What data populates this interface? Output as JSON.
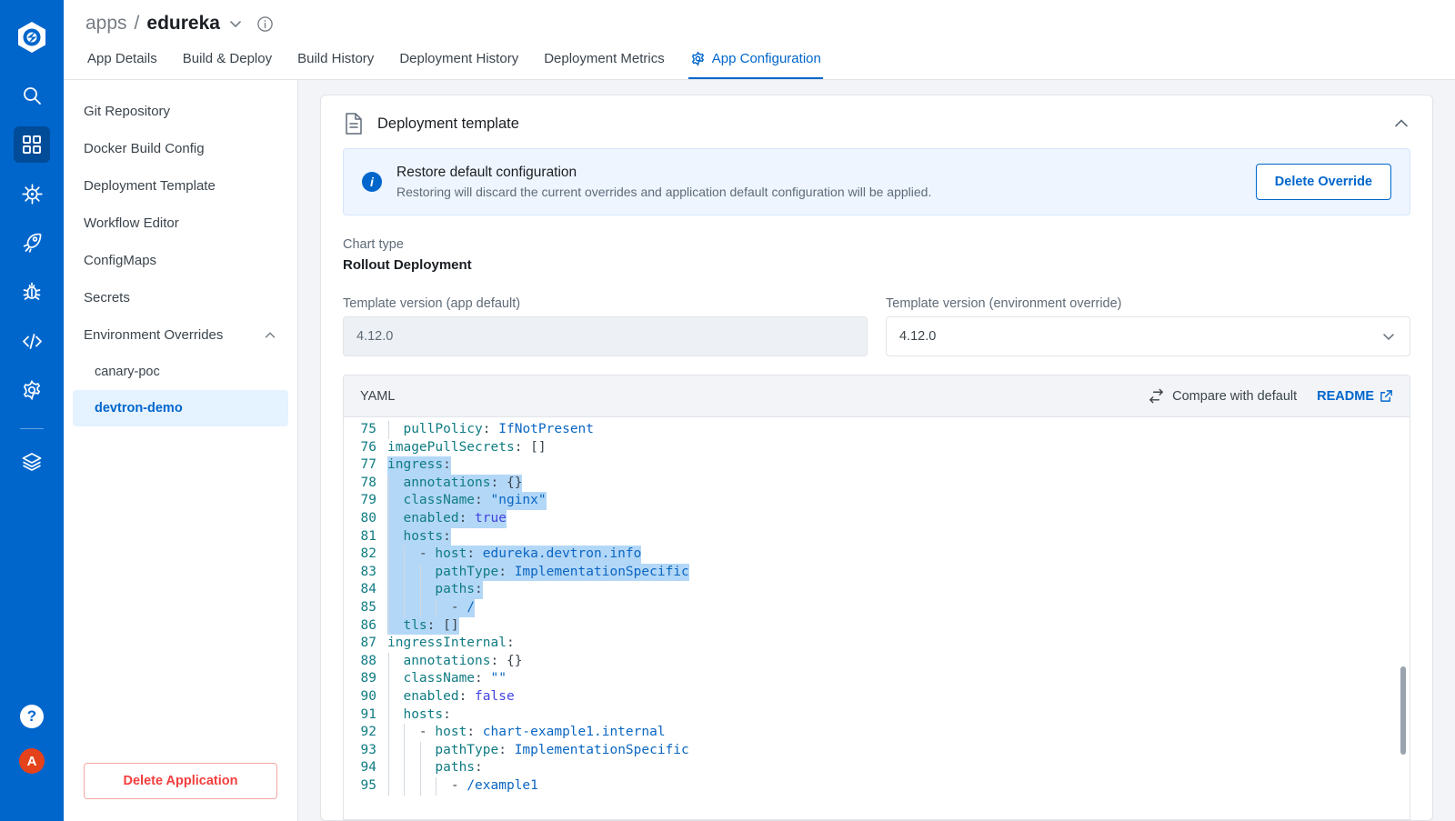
{
  "rail": {
    "logo_name": "devtron-logo",
    "items": [
      {
        "name": "search-icon",
        "label": "Search",
        "active": false
      },
      {
        "name": "apps-grid-icon",
        "label": "Applications",
        "active": true
      },
      {
        "name": "chart-store-icon",
        "label": "Chart Store",
        "active": false
      },
      {
        "name": "rocket-icon",
        "label": "Deployments",
        "active": false
      },
      {
        "name": "bug-icon",
        "label": "Security",
        "active": false
      },
      {
        "name": "code-icon",
        "label": "Jobs",
        "active": false
      },
      {
        "name": "gear-icon",
        "label": "Global Configurations",
        "active": false
      },
      {
        "name": "stack-icon",
        "label": "Stack Manager",
        "active": false
      }
    ],
    "help_label": "?",
    "avatar_label": "A"
  },
  "header": {
    "breadcrumb_root": "apps",
    "breadcrumb_sep": "/",
    "app_name": "edureka",
    "chevron_icon": "chevron-down-icon",
    "info_icon": "info-circle-icon",
    "tabs": [
      {
        "label": "App Details",
        "active": false
      },
      {
        "label": "Build & Deploy",
        "active": false
      },
      {
        "label": "Build History",
        "active": false
      },
      {
        "label": "Deployment History",
        "active": false
      },
      {
        "label": "Deployment Metrics",
        "active": false
      },
      {
        "label": "App Configuration",
        "active": true,
        "icon": "gear-icon"
      }
    ]
  },
  "sidebar": {
    "items": [
      {
        "label": "Git Repository",
        "type": "item"
      },
      {
        "label": "Docker Build Config",
        "type": "item"
      },
      {
        "label": "Deployment Template",
        "type": "item"
      },
      {
        "label": "Workflow Editor",
        "type": "item"
      },
      {
        "label": "ConfigMaps",
        "type": "item"
      },
      {
        "label": "Secrets",
        "type": "item"
      },
      {
        "label": "Environment Overrides",
        "type": "group",
        "expanded": true,
        "icon": "chevron-up-icon"
      },
      {
        "label": "canary-poc",
        "type": "sub",
        "selected": false
      },
      {
        "label": "devtron-demo",
        "type": "sub",
        "selected": true
      }
    ],
    "delete_app_label": "Delete Application"
  },
  "card": {
    "doc_icon": "document-icon",
    "title": "Deployment template",
    "collapse_icon": "chevron-up-icon",
    "banner": {
      "icon": "info-circle-filled-icon",
      "title": "Restore default configuration",
      "subtitle": "Restoring will discard the current overrides and application default configuration will be applied.",
      "button_label": "Delete Override"
    },
    "chart_type_label": "Chart type",
    "chart_type_value": "Rollout Deployment",
    "version_app_label": "Template version (app default)",
    "version_app_value": "4.12.0",
    "version_env_label": "Template version (environment override)",
    "version_env_value": "4.12.0",
    "version_env_chevron": "chevron-down-icon"
  },
  "editor": {
    "tab_label": "YAML",
    "compare_label": "Compare with default",
    "compare_icon": "compare-arrows-icon",
    "readme_label": "README",
    "readme_icon": "external-link-icon",
    "first_line": 75,
    "lines": [
      {
        "n": 75,
        "indent": 1,
        "guides": 1,
        "hl": false,
        "tokens": [
          {
            "t": "  ",
            "c": "p"
          },
          {
            "t": "pullPolicy",
            "c": "k"
          },
          {
            "t": ": ",
            "c": "p"
          },
          {
            "t": "IfNotPresent",
            "c": "s"
          }
        ]
      },
      {
        "n": 76,
        "indent": 0,
        "guides": 0,
        "hl": false,
        "tokens": [
          {
            "t": "imagePullSecrets",
            "c": "k"
          },
          {
            "t": ": []",
            "c": "p"
          }
        ]
      },
      {
        "n": 77,
        "indent": 0,
        "guides": 0,
        "hl": true,
        "tokens": [
          {
            "t": "ingress",
            "c": "k"
          },
          {
            "t": ":",
            "c": "p"
          }
        ]
      },
      {
        "n": 78,
        "indent": 1,
        "guides": 1,
        "hl": true,
        "tokens": [
          {
            "t": "  ",
            "c": "p"
          },
          {
            "t": "annotations",
            "c": "k"
          },
          {
            "t": ": {}",
            "c": "p"
          }
        ]
      },
      {
        "n": 79,
        "indent": 1,
        "guides": 1,
        "hl": true,
        "tokens": [
          {
            "t": "  ",
            "c": "p"
          },
          {
            "t": "className",
            "c": "k"
          },
          {
            "t": ": ",
            "c": "p"
          },
          {
            "t": "\"nginx\"",
            "c": "s"
          }
        ]
      },
      {
        "n": 80,
        "indent": 1,
        "guides": 1,
        "hl": true,
        "tokens": [
          {
            "t": "  ",
            "c": "p"
          },
          {
            "t": "enabled",
            "c": "k"
          },
          {
            "t": ": ",
            "c": "p"
          },
          {
            "t": "true",
            "c": "b"
          }
        ]
      },
      {
        "n": 81,
        "indent": 1,
        "guides": 1,
        "hl": true,
        "tokens": [
          {
            "t": "  ",
            "c": "p"
          },
          {
            "t": "hosts",
            "c": "k"
          },
          {
            "t": ":",
            "c": "p"
          }
        ]
      },
      {
        "n": 82,
        "indent": 2,
        "guides": 2,
        "hl": true,
        "tokens": [
          {
            "t": "    ",
            "c": "p"
          },
          {
            "t": "- ",
            "c": "d"
          },
          {
            "t": "host",
            "c": "k"
          },
          {
            "t": ": ",
            "c": "p"
          },
          {
            "t": "edureka.devtron.info",
            "c": "s"
          }
        ]
      },
      {
        "n": 83,
        "indent": 3,
        "guides": 3,
        "hl": true,
        "tokens": [
          {
            "t": "      ",
            "c": "p"
          },
          {
            "t": "pathType",
            "c": "k"
          },
          {
            "t": ": ",
            "c": "p"
          },
          {
            "t": "ImplementationSpecific",
            "c": "s"
          }
        ]
      },
      {
        "n": 84,
        "indent": 3,
        "guides": 3,
        "hl": true,
        "tokens": [
          {
            "t": "      ",
            "c": "p"
          },
          {
            "t": "paths",
            "c": "k"
          },
          {
            "t": ":",
            "c": "p"
          }
        ]
      },
      {
        "n": 85,
        "indent": 4,
        "guides": 4,
        "hl": true,
        "tokens": [
          {
            "t": "        ",
            "c": "p"
          },
          {
            "t": "- ",
            "c": "d"
          },
          {
            "t": "/",
            "c": "s"
          }
        ]
      },
      {
        "n": 86,
        "indent": 1,
        "guides": 1,
        "hl": true,
        "tokens": [
          {
            "t": "  ",
            "c": "p"
          },
          {
            "t": "tls",
            "c": "k"
          },
          {
            "t": ": []",
            "c": "p"
          }
        ]
      },
      {
        "n": 87,
        "indent": 0,
        "guides": 0,
        "hl": false,
        "tokens": [
          {
            "t": "ingressInternal",
            "c": "k"
          },
          {
            "t": ":",
            "c": "p"
          }
        ]
      },
      {
        "n": 88,
        "indent": 1,
        "guides": 1,
        "hl": false,
        "tokens": [
          {
            "t": "  ",
            "c": "p"
          },
          {
            "t": "annotations",
            "c": "k"
          },
          {
            "t": ": {}",
            "c": "p"
          }
        ]
      },
      {
        "n": 89,
        "indent": 1,
        "guides": 1,
        "hl": false,
        "tokens": [
          {
            "t": "  ",
            "c": "p"
          },
          {
            "t": "className",
            "c": "k"
          },
          {
            "t": ": ",
            "c": "p"
          },
          {
            "t": "\"\"",
            "c": "s"
          }
        ]
      },
      {
        "n": 90,
        "indent": 1,
        "guides": 1,
        "hl": false,
        "tokens": [
          {
            "t": "  ",
            "c": "p"
          },
          {
            "t": "enabled",
            "c": "k"
          },
          {
            "t": ": ",
            "c": "p"
          },
          {
            "t": "false",
            "c": "b"
          }
        ]
      },
      {
        "n": 91,
        "indent": 1,
        "guides": 1,
        "hl": false,
        "tokens": [
          {
            "t": "  ",
            "c": "p"
          },
          {
            "t": "hosts",
            "c": "k"
          },
          {
            "t": ":",
            "c": "p"
          }
        ]
      },
      {
        "n": 92,
        "indent": 2,
        "guides": 2,
        "hl": false,
        "tokens": [
          {
            "t": "    ",
            "c": "p"
          },
          {
            "t": "- ",
            "c": "d"
          },
          {
            "t": "host",
            "c": "k"
          },
          {
            "t": ": ",
            "c": "p"
          },
          {
            "t": "chart-example1.internal",
            "c": "s"
          }
        ]
      },
      {
        "n": 93,
        "indent": 3,
        "guides": 3,
        "hl": false,
        "tokens": [
          {
            "t": "      ",
            "c": "p"
          },
          {
            "t": "pathType",
            "c": "k"
          },
          {
            "t": ": ",
            "c": "p"
          },
          {
            "t": "ImplementationSpecific",
            "c": "s"
          }
        ]
      },
      {
        "n": 94,
        "indent": 3,
        "guides": 3,
        "hl": false,
        "tokens": [
          {
            "t": "      ",
            "c": "p"
          },
          {
            "t": "paths",
            "c": "k"
          },
          {
            "t": ":",
            "c": "p"
          }
        ]
      },
      {
        "n": 95,
        "indent": 4,
        "guides": 4,
        "hl": false,
        "tokens": [
          {
            "t": "        ",
            "c": "p"
          },
          {
            "t": "- ",
            "c": "d"
          },
          {
            "t": "/example1",
            "c": "s"
          }
        ]
      }
    ],
    "scrollbar": {
      "top_pct": 62,
      "height_pct": 22
    }
  },
  "colors": {
    "brand_blue": "#0066cc",
    "rail_active": "#004c99",
    "selection_blue": "#b3d7f7",
    "banner_bg": "#eef5ff",
    "danger_red": "#f33e3e",
    "avatar_orange": "#e4421a",
    "key_teal": "#0f7b83"
  }
}
